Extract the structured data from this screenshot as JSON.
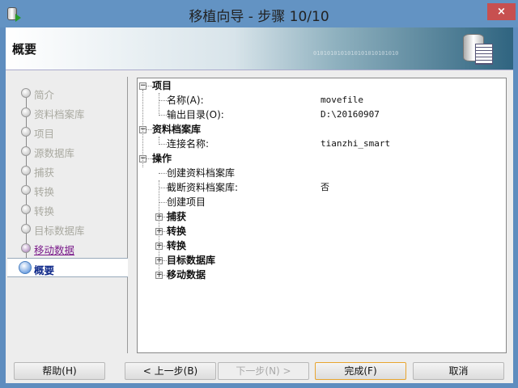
{
  "window": {
    "title": "移植向导 - 步骤 10/10",
    "close": "×"
  },
  "header": {
    "title": "概要",
    "binary": "0101010101010101010101010"
  },
  "steps": [
    {
      "label": "简介",
      "state": "disabled"
    },
    {
      "label": "资料档案库",
      "state": "disabled"
    },
    {
      "label": "项目",
      "state": "disabled"
    },
    {
      "label": "源数据库",
      "state": "disabled"
    },
    {
      "label": "捕获",
      "state": "disabled"
    },
    {
      "label": "转换",
      "state": "disabled"
    },
    {
      "label": "转换",
      "state": "disabled"
    },
    {
      "label": "目标数据库",
      "state": "disabled"
    },
    {
      "label": "移动数据",
      "state": "visited"
    },
    {
      "label": "概要",
      "state": "current"
    }
  ],
  "tree": {
    "project": {
      "label": "项目",
      "name_label": "名称(A):",
      "name_value": "movefile",
      "output_label": "输出目录(O):",
      "output_value": "D:\\20160907"
    },
    "repository": {
      "label": "资料档案库",
      "conn_label": "连接名称:",
      "conn_value": "tianzhi_smart"
    },
    "operations": {
      "label": "操作",
      "create_repo": "创建资料档案库",
      "truncate_label": "截断资料档案库:",
      "truncate_value": "否",
      "create_project": "创建项目",
      "children": [
        "捕获",
        "转换",
        "转换",
        "目标数据库",
        "移动数据"
      ]
    }
  },
  "buttons": {
    "help": "帮助(H)",
    "back": "< 上一步(B)",
    "next": "下一步(N) >",
    "finish": "完成(F)",
    "cancel": "取消"
  }
}
